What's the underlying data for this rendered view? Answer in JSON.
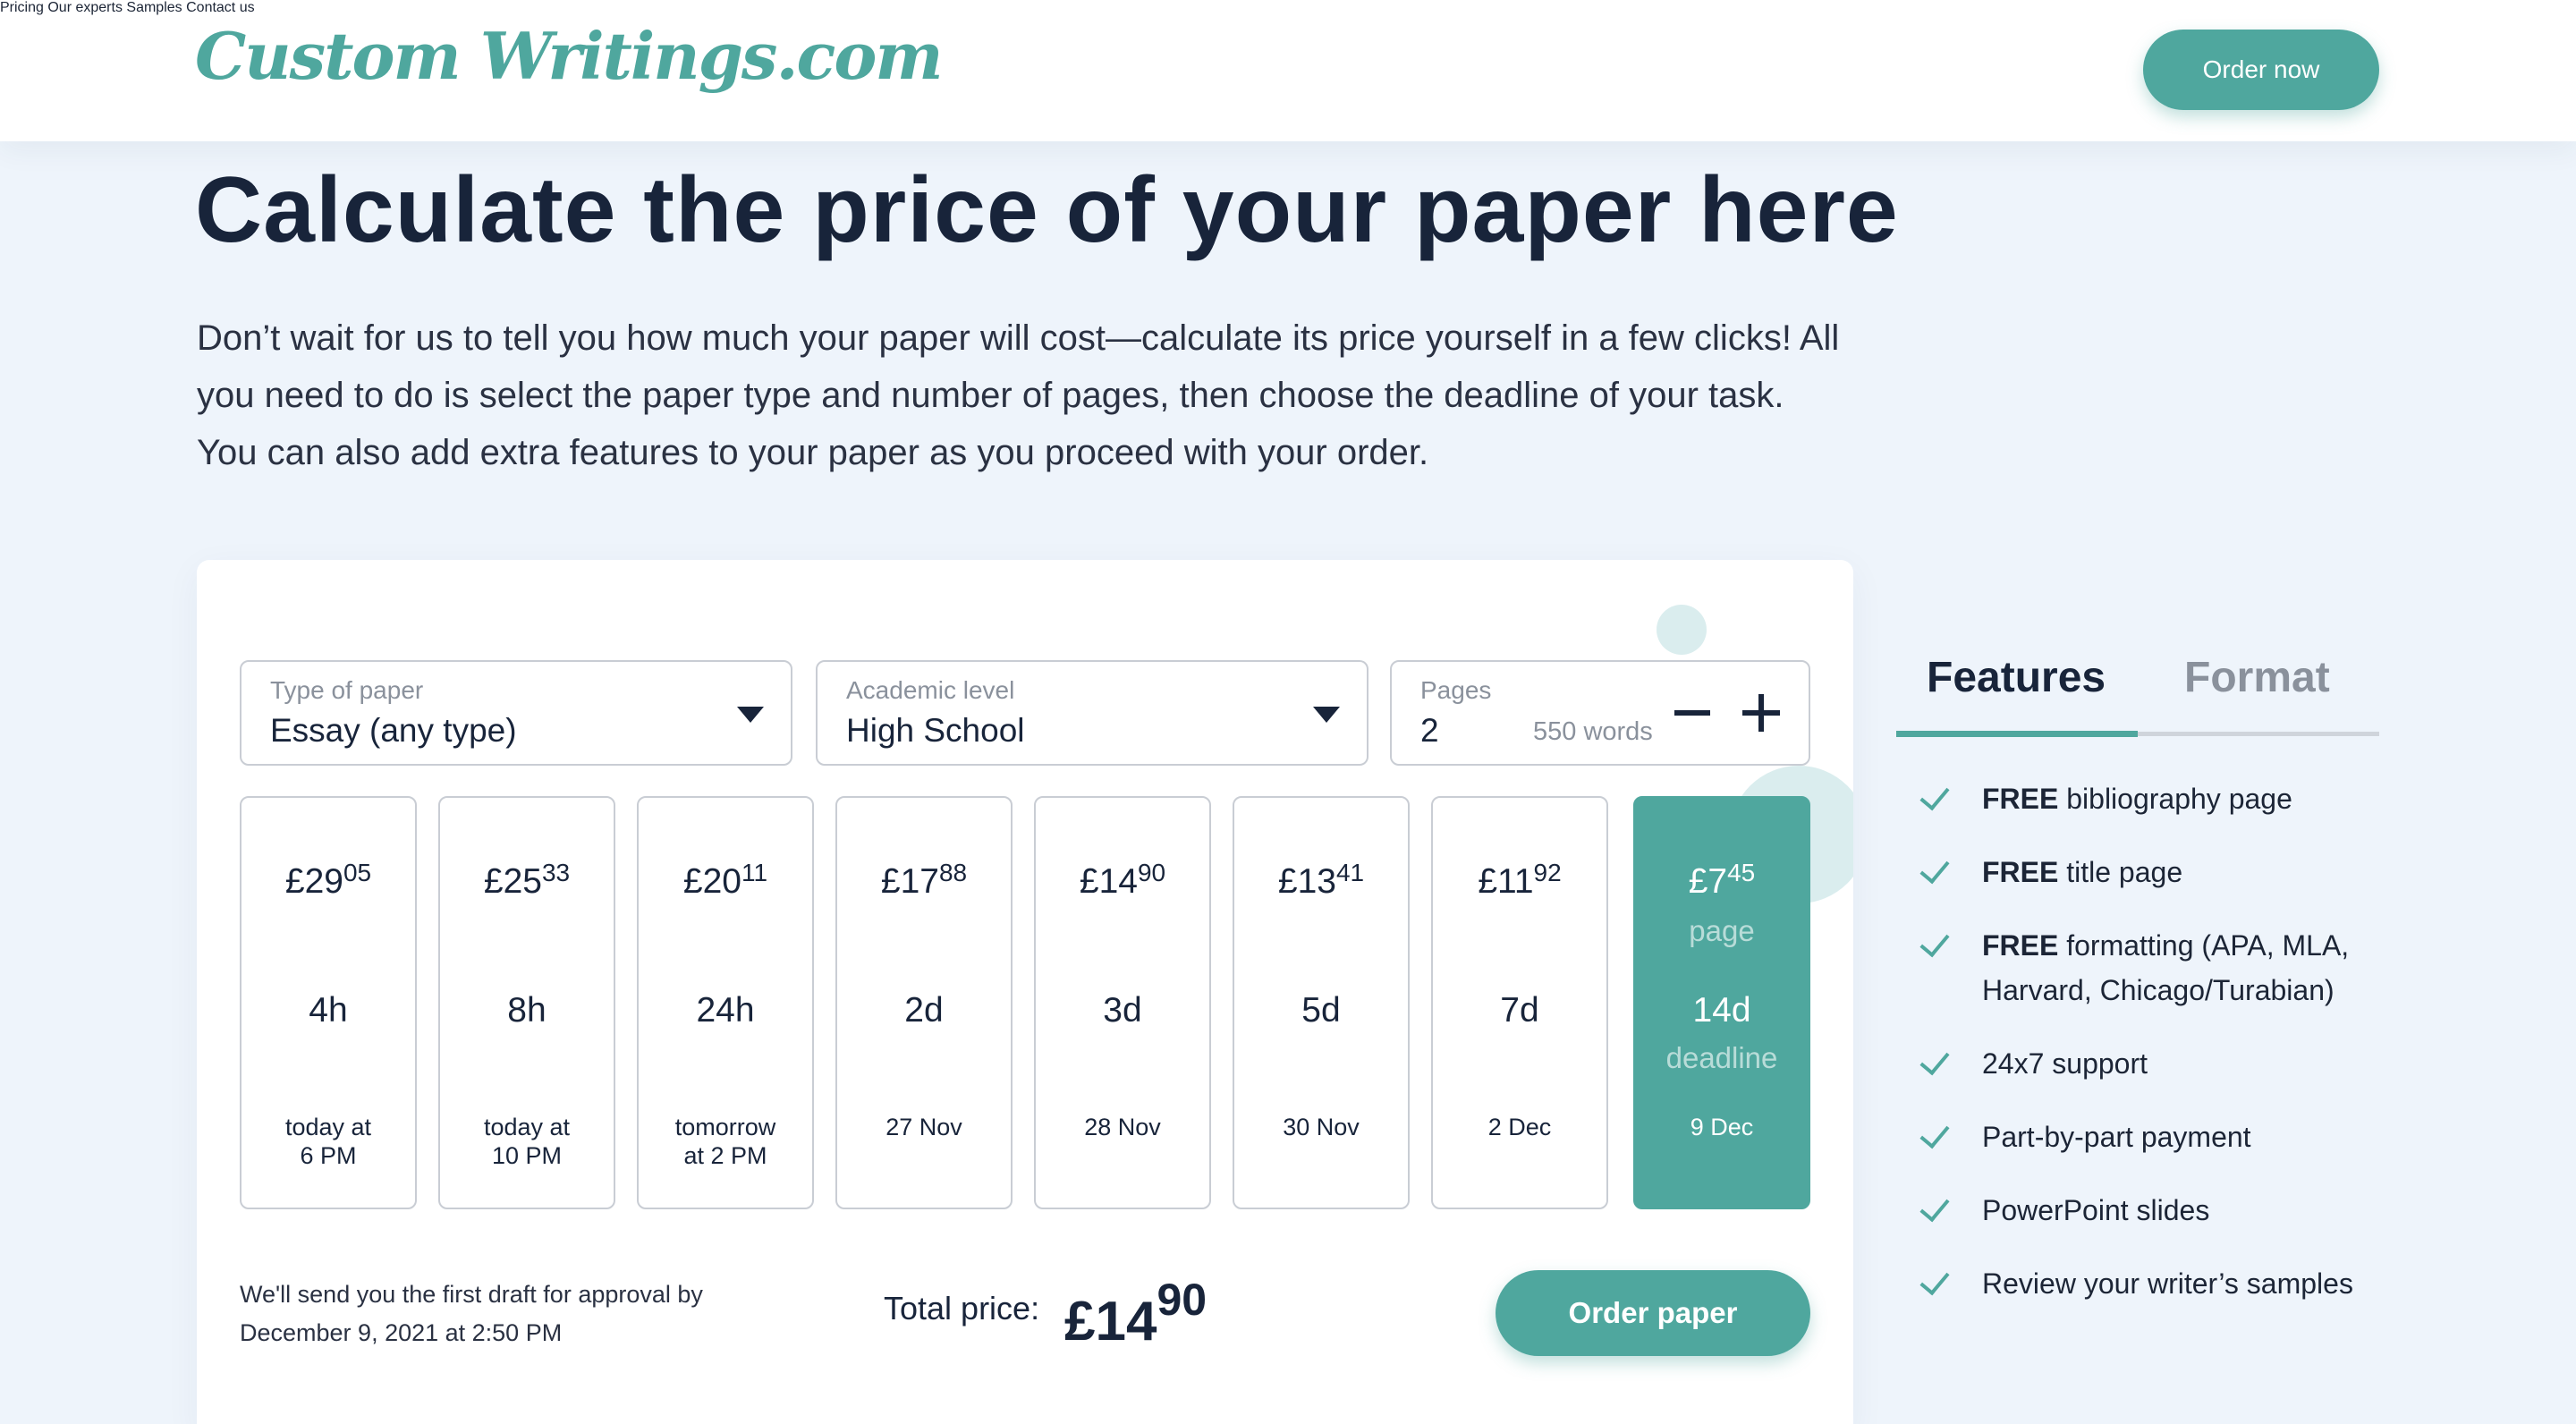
{
  "header": {
    "logo_text": "Custom Writings.com",
    "nav": [
      "Pricing",
      "Our experts",
      "Samples",
      "Contact us"
    ],
    "order_now": "Order now"
  },
  "hero": {
    "title": "Calculate the price of your paper here",
    "description": "Don’t wait for us to tell you how much your paper will cost—calculate its price yourself in a few clicks! All you need to do is select the paper type and number of pages, then choose the deadline of your task. You can also add extra features to your paper as you proceed with your order."
  },
  "calculator": {
    "paper_type": {
      "label": "Type of paper",
      "value": "Essay (any type)"
    },
    "academic_level": {
      "label": "Academic level",
      "value": "High School"
    },
    "pages": {
      "label": "Pages",
      "value": "2",
      "words": "550 words"
    },
    "deadlines": [
      {
        "price_main": "£29",
        "price_cents": "05",
        "time": "4h",
        "date": "today at\n6 PM"
      },
      {
        "price_main": "£25",
        "price_cents": "33",
        "time": "8h",
        "date": "today at\n10 PM"
      },
      {
        "price_main": "£20",
        "price_cents": "11",
        "time": "24h",
        "date": "tomorrow\nat 2 PM"
      },
      {
        "price_main": "£17",
        "price_cents": "88",
        "time": "2d",
        "date": "27 Nov"
      },
      {
        "price_main": "£14",
        "price_cents": "90",
        "time": "3d",
        "date": "28 Nov"
      },
      {
        "price_main": "£13",
        "price_cents": "41",
        "time": "5d",
        "date": "30 Nov"
      },
      {
        "price_main": "£11",
        "price_cents": "92",
        "time": "7d",
        "date": "2 Dec"
      },
      {
        "price_main": "£7",
        "price_cents": "45",
        "per": "page",
        "time": "14d",
        "deadline_word": "deadline",
        "date": "9 Dec",
        "selected": true
      }
    ],
    "draft_note": "We'll send you the first draft for approval by December 9, 2021 at 2:50 PM",
    "total_label": "Total price:",
    "total_main": "£14",
    "total_cents": "90",
    "order_button": "Order paper"
  },
  "side_panel": {
    "tabs": [
      "Features",
      "Format"
    ],
    "active_tab": "Features",
    "features": [
      {
        "bold": "FREE",
        "text": " bibliography page"
      },
      {
        "bold": "FREE",
        "text": " title page"
      },
      {
        "bold": "FREE",
        "text": " formatting (APA, MLA, Harvard, Chicago/Turabian)"
      },
      {
        "bold": "",
        "text": "24x7 support"
      },
      {
        "bold": "",
        "text": "Part-by-part payment"
      },
      {
        "bold": "",
        "text": "PowerPoint slides"
      },
      {
        "bold": "",
        "text": "Review your writer’s samples"
      }
    ]
  },
  "colors": {
    "accent": "#4fa79e",
    "text": "#18243a",
    "background": "#eef4fb",
    "muted": "#8a919c"
  }
}
